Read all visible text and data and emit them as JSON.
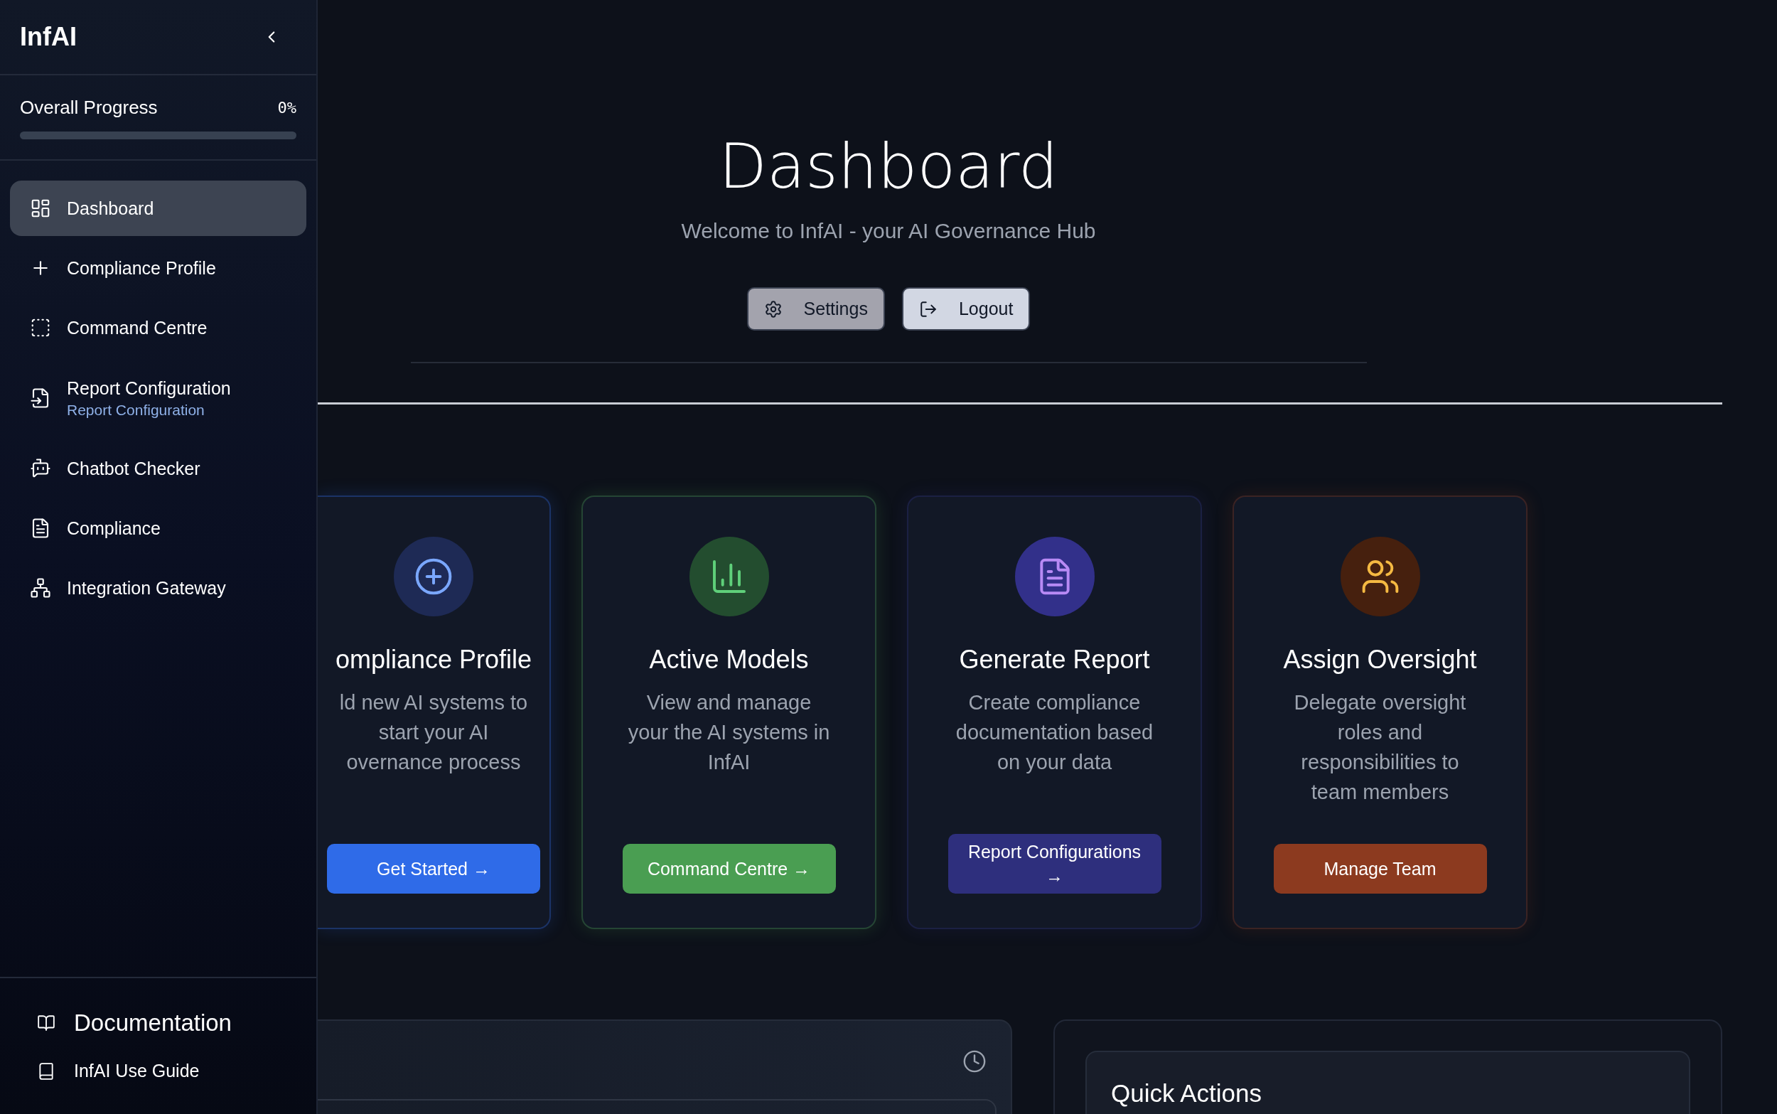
{
  "sidebar": {
    "brand": "InfAI",
    "progress": {
      "label": "Overall Progress",
      "reading": "0%",
      "level": 0
    },
    "nav": [
      {
        "label": "Dashboard",
        "selected": true
      },
      {
        "label": "Compliance Profile",
        "selected": false
      },
      {
        "label": "Command Centre",
        "selected": false
      },
      {
        "label": "Report Configuration",
        "sublabel": "Report Configuration",
        "selected": false
      },
      {
        "label": "Chatbot Checker",
        "selected": false
      },
      {
        "label": "Compliance",
        "selected": false
      },
      {
        "label": "Integration Gateway",
        "selected": false
      }
    ],
    "footer": [
      {
        "label": "Documentation",
        "kind": "heading"
      },
      {
        "label": "InfAI Use Guide",
        "kind": "link"
      }
    ]
  },
  "header": {
    "title": "Dashboard",
    "subtitle": "Welcome to InfAI - your AI Governance Hub",
    "buttons": [
      {
        "label": "Settings",
        "kind": "settings"
      },
      {
        "label": "Logout",
        "kind": "logout"
      }
    ]
  },
  "cards": [
    {
      "title": "ompliance Profile",
      "lines": [
        "ld new AI systems to",
        "start your AI",
        "overnance process"
      ],
      "action": "Get Started →",
      "color": "#2f6be8"
    },
    {
      "title": "Active Models",
      "lines": [
        "View and manage",
        "your the AI systems in",
        "InfAI"
      ],
      "action": "Command Centre →",
      "color": "#4a9e52"
    },
    {
      "title": "Generate Report",
      "lines": [
        "Create compliance",
        "documentation based",
        "on your data"
      ],
      "action": "Report Configurations →",
      "color": "#2e2f7d"
    },
    {
      "title": "Assign Oversight",
      "lines": [
        "Delegate oversight",
        "roles and",
        "responsibilities to",
        "team members"
      ],
      "action": "Manage Team",
      "color": "#8c3a1f"
    }
  ],
  "quick_actions": {
    "title": "Quick Actions"
  }
}
